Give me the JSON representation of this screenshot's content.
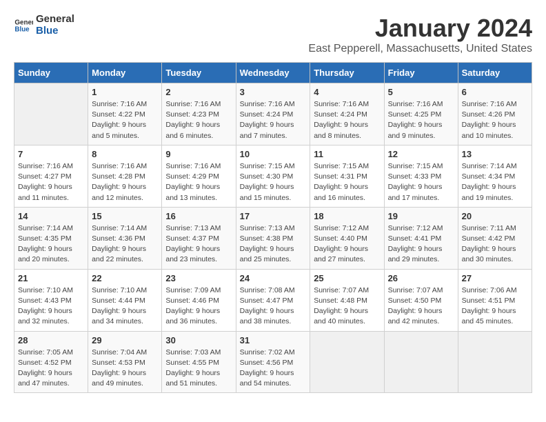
{
  "header": {
    "logo_line1": "General",
    "logo_line2": "Blue",
    "title": "January 2024",
    "subtitle": "East Pepperell, Massachusetts, United States"
  },
  "calendar": {
    "days_of_week": [
      "Sunday",
      "Monday",
      "Tuesday",
      "Wednesday",
      "Thursday",
      "Friday",
      "Saturday"
    ],
    "weeks": [
      [
        {
          "date": "",
          "detail": ""
        },
        {
          "date": "1",
          "detail": "Sunrise: 7:16 AM\nSunset: 4:22 PM\nDaylight: 9 hours\nand 5 minutes."
        },
        {
          "date": "2",
          "detail": "Sunrise: 7:16 AM\nSunset: 4:23 PM\nDaylight: 9 hours\nand 6 minutes."
        },
        {
          "date": "3",
          "detail": "Sunrise: 7:16 AM\nSunset: 4:24 PM\nDaylight: 9 hours\nand 7 minutes."
        },
        {
          "date": "4",
          "detail": "Sunrise: 7:16 AM\nSunset: 4:24 PM\nDaylight: 9 hours\nand 8 minutes."
        },
        {
          "date": "5",
          "detail": "Sunrise: 7:16 AM\nSunset: 4:25 PM\nDaylight: 9 hours\nand 9 minutes."
        },
        {
          "date": "6",
          "detail": "Sunrise: 7:16 AM\nSunset: 4:26 PM\nDaylight: 9 hours\nand 10 minutes."
        }
      ],
      [
        {
          "date": "7",
          "detail": "Sunrise: 7:16 AM\nSunset: 4:27 PM\nDaylight: 9 hours\nand 11 minutes."
        },
        {
          "date": "8",
          "detail": "Sunrise: 7:16 AM\nSunset: 4:28 PM\nDaylight: 9 hours\nand 12 minutes."
        },
        {
          "date": "9",
          "detail": "Sunrise: 7:16 AM\nSunset: 4:29 PM\nDaylight: 9 hours\nand 13 minutes."
        },
        {
          "date": "10",
          "detail": "Sunrise: 7:15 AM\nSunset: 4:30 PM\nDaylight: 9 hours\nand 15 minutes."
        },
        {
          "date": "11",
          "detail": "Sunrise: 7:15 AM\nSunset: 4:31 PM\nDaylight: 9 hours\nand 16 minutes."
        },
        {
          "date": "12",
          "detail": "Sunrise: 7:15 AM\nSunset: 4:33 PM\nDaylight: 9 hours\nand 17 minutes."
        },
        {
          "date": "13",
          "detail": "Sunrise: 7:14 AM\nSunset: 4:34 PM\nDaylight: 9 hours\nand 19 minutes."
        }
      ],
      [
        {
          "date": "14",
          "detail": "Sunrise: 7:14 AM\nSunset: 4:35 PM\nDaylight: 9 hours\nand 20 minutes."
        },
        {
          "date": "15",
          "detail": "Sunrise: 7:14 AM\nSunset: 4:36 PM\nDaylight: 9 hours\nand 22 minutes."
        },
        {
          "date": "16",
          "detail": "Sunrise: 7:13 AM\nSunset: 4:37 PM\nDaylight: 9 hours\nand 23 minutes."
        },
        {
          "date": "17",
          "detail": "Sunrise: 7:13 AM\nSunset: 4:38 PM\nDaylight: 9 hours\nand 25 minutes."
        },
        {
          "date": "18",
          "detail": "Sunrise: 7:12 AM\nSunset: 4:40 PM\nDaylight: 9 hours\nand 27 minutes."
        },
        {
          "date": "19",
          "detail": "Sunrise: 7:12 AM\nSunset: 4:41 PM\nDaylight: 9 hours\nand 29 minutes."
        },
        {
          "date": "20",
          "detail": "Sunrise: 7:11 AM\nSunset: 4:42 PM\nDaylight: 9 hours\nand 30 minutes."
        }
      ],
      [
        {
          "date": "21",
          "detail": "Sunrise: 7:10 AM\nSunset: 4:43 PM\nDaylight: 9 hours\nand 32 minutes."
        },
        {
          "date": "22",
          "detail": "Sunrise: 7:10 AM\nSunset: 4:44 PM\nDaylight: 9 hours\nand 34 minutes."
        },
        {
          "date": "23",
          "detail": "Sunrise: 7:09 AM\nSunset: 4:46 PM\nDaylight: 9 hours\nand 36 minutes."
        },
        {
          "date": "24",
          "detail": "Sunrise: 7:08 AM\nSunset: 4:47 PM\nDaylight: 9 hours\nand 38 minutes."
        },
        {
          "date": "25",
          "detail": "Sunrise: 7:07 AM\nSunset: 4:48 PM\nDaylight: 9 hours\nand 40 minutes."
        },
        {
          "date": "26",
          "detail": "Sunrise: 7:07 AM\nSunset: 4:50 PM\nDaylight: 9 hours\nand 42 minutes."
        },
        {
          "date": "27",
          "detail": "Sunrise: 7:06 AM\nSunset: 4:51 PM\nDaylight: 9 hours\nand 45 minutes."
        }
      ],
      [
        {
          "date": "28",
          "detail": "Sunrise: 7:05 AM\nSunset: 4:52 PM\nDaylight: 9 hours\nand 47 minutes."
        },
        {
          "date": "29",
          "detail": "Sunrise: 7:04 AM\nSunset: 4:53 PM\nDaylight: 9 hours\nand 49 minutes."
        },
        {
          "date": "30",
          "detail": "Sunrise: 7:03 AM\nSunset: 4:55 PM\nDaylight: 9 hours\nand 51 minutes."
        },
        {
          "date": "31",
          "detail": "Sunrise: 7:02 AM\nSunset: 4:56 PM\nDaylight: 9 hours\nand 54 minutes."
        },
        {
          "date": "",
          "detail": ""
        },
        {
          "date": "",
          "detail": ""
        },
        {
          "date": "",
          "detail": ""
        }
      ]
    ]
  }
}
